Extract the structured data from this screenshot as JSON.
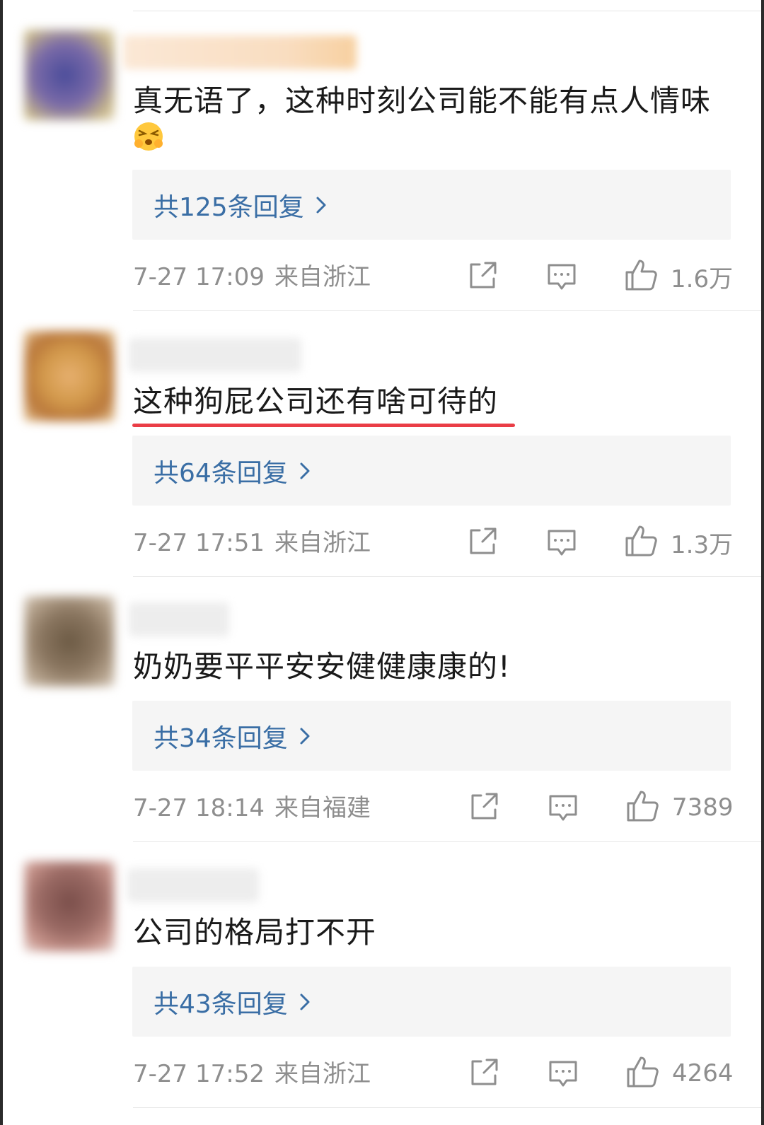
{
  "comments": [
    {
      "text": "真无语了，这种时刻公司能不能有点人情味",
      "emoji": "grimacing-emoji",
      "replies": "共125条回复",
      "time": "7-27 17:09",
      "location": "来自浙江",
      "likes": "1.6万",
      "avatar_color": "#7a6aa8"
    },
    {
      "text": "这种狗屁公司还有啥可待的",
      "replies": "共64条回复",
      "time": "7-27 17:51",
      "location": "来自浙江",
      "likes": "1.3万",
      "avatar_color": "#d39a4c"
    },
    {
      "text": "奶奶要平平安安健健康康的!",
      "replies": "共34条回复",
      "time": "7-27 18:14",
      "location": "来自福建",
      "likes": "7389",
      "avatar_color": "#8a7660"
    },
    {
      "text": "公司的格局打不开",
      "replies": "共43条回复",
      "time": "7-27 17:52",
      "location": "来自浙江",
      "likes": "4264",
      "avatar_color": "#9a6a64"
    }
  ],
  "colors": {
    "reply_link": "#3a6ea5",
    "underline": "#ea3d46",
    "meta": "#8e8e8e"
  }
}
